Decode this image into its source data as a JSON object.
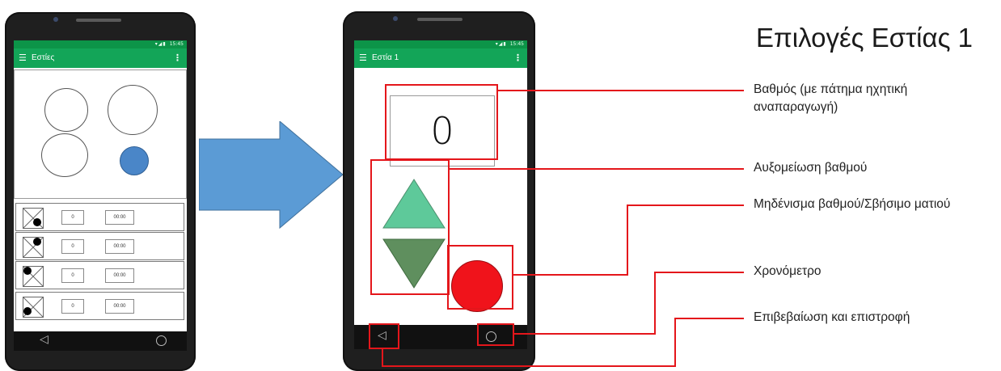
{
  "heading": "Επιλογές Εστίας 1",
  "left_phone": {
    "status_time": "15:45",
    "appbar_title": "Εστίες",
    "rows": [
      {
        "score": "0",
        "time": "00:00"
      },
      {
        "score": "0",
        "time": "00:00"
      },
      {
        "score": "0",
        "time": "00:00"
      },
      {
        "score": "0",
        "time": "00:00"
      }
    ]
  },
  "right_phone": {
    "status_time": "15:45",
    "appbar_title": "Εστία 1",
    "score_value": "0"
  },
  "callouts": [
    {
      "label": "Βαθμός (με πάτημα ηχητική αναπαραγωγή)"
    },
    {
      "label": "Αυξομείωση βαθμού"
    },
    {
      "label": "Μηδένισμα βαθμού/Σβήσιμο ματιού"
    },
    {
      "label": "Χρονόμετρο"
    },
    {
      "label": "Επιβεβαίωση και επιστροφή"
    }
  ],
  "icons": {
    "menu": "hamburger-icon",
    "more": "more-vert-icon",
    "back": "back-triangle-icon",
    "home": "home-circle-icon",
    "arrow": "right-arrow-icon"
  },
  "colors": {
    "appbar": "#13a558",
    "statusbar": "#0c9448",
    "up_triangle": "#5ec99a",
    "down_triangle": "#5f8f5e",
    "record_button": "#f0131b",
    "highlight": "#e4161b",
    "arrow": "#5b9bd5",
    "selected_circle": "#4a86c8"
  }
}
